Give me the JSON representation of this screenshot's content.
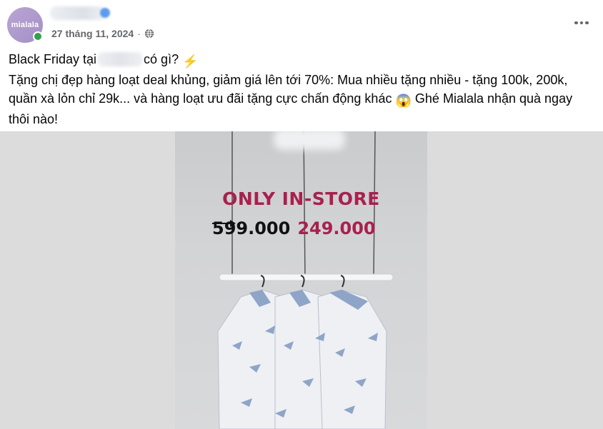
{
  "post": {
    "avatar_text": "mialala",
    "date": "27 tháng 11, 2024",
    "separator": "·",
    "more_icon": "more-horizontal-icon",
    "privacy_icon": "globe-icon",
    "text": {
      "line1_before": "Black Friday tại",
      "line1_after": "có gì?",
      "line1_emoji": "⚡",
      "body_before_emoji": "Tặng chị đẹp hàng loạt deal khủng, giảm giá lên tới 70%: Mua nhiều tặng nhiều - tặng 100k, 200k, quần xà lỏn chỉ 29k... và hàng loạt ưu đãi tặng cực chấn động khác",
      "body_emoji": "😱",
      "body_after_emoji": "Ghé Mialala nhận quà ngay thôi nào!"
    }
  },
  "image": {
    "promo_title": "ONLY IN-STORE",
    "old_price": "599.000",
    "new_price": "249.000",
    "colors": {
      "accent": "#a8214d",
      "background": "#d3d4d6"
    }
  }
}
